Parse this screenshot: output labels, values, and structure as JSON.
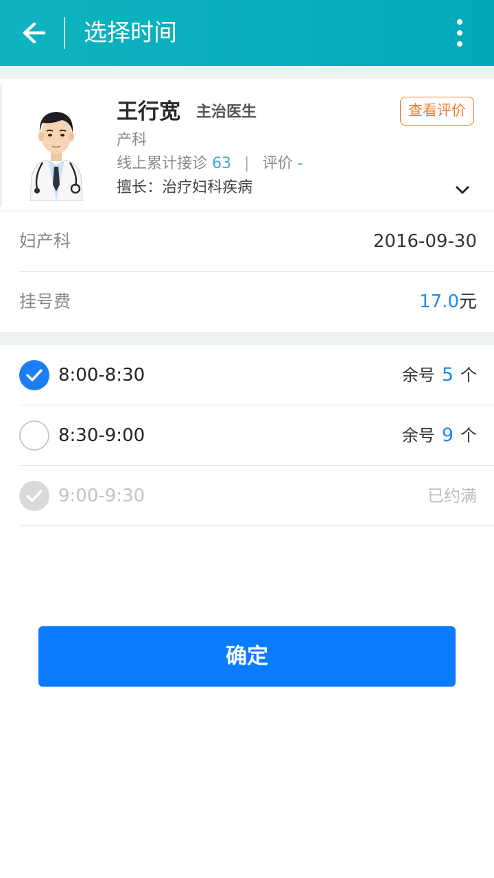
{
  "header": {
    "title": "选择时间",
    "back_icon": "arrow-left-icon",
    "more_icon": "more-vertical-icon"
  },
  "doctor": {
    "name": "王行宽",
    "title": "主治医生",
    "department": "产科",
    "consult_label": "线上累计接诊",
    "consult_count": "63",
    "rating_label": "评价",
    "rating_value": "-",
    "specialty": "擅长：治疗妇科疾病",
    "review_button": "查看评价",
    "expand_icon": "chevron-down-icon"
  },
  "info": {
    "department": "妇产科",
    "date": "2016-09-30",
    "fee_label": "挂号费",
    "fee_value": "17.0",
    "fee_unit": "元"
  },
  "slots": [
    {
      "time": "8:00-8:30",
      "state": "selected",
      "remain_label": "余号",
      "remain_count": "5",
      "remain_unit": "个"
    },
    {
      "time": "8:30-9:00",
      "state": "available",
      "remain_label": "余号",
      "remain_count": "9",
      "remain_unit": "个"
    },
    {
      "time": "9:00-9:30",
      "state": "full",
      "status_text": "已约满"
    }
  ],
  "confirm_button": "确定",
  "colors": {
    "header_bg": "#00a9b8",
    "accent_blue": "#0a7cff",
    "link_blue": "#1a8bf0",
    "orange": "#f07a28",
    "disabled": "#bdbdbd"
  }
}
